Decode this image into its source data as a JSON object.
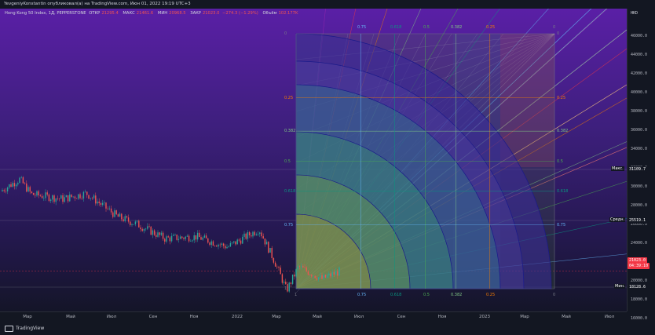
{
  "header": {
    "title": "YevgeniyKonstantin опубликовал(а) на TradingView.com, Июн 01, 2022 19:19 UTC+3"
  },
  "legend": {
    "symbol": "Hong Kong 50 Index, 1Д, PEPPERSTONE",
    "open_label": "ОТКР",
    "open_value": "21295.4",
    "high_label": "МАКС",
    "high_value": "21461.6",
    "low_label": "МИН",
    "low_value": "20968.5",
    "close_label": "ЗАКР",
    "close_value": "21023.0",
    "change": "−274.3 (−1.29%)",
    "volume_label": "Объём",
    "volume_value": "102.177K"
  },
  "price_axis": {
    "currency": "HKD",
    "ticks": [
      "46000.0",
      "44000.0",
      "42000.0",
      "40000.0",
      "38000.0",
      "36000.0",
      "34000.0",
      "32000.0",
      "30000.0",
      "28000.0",
      "26000.0",
      "24000.0",
      "22000.0",
      "20000.0",
      "18000.0",
      "16000.0"
    ],
    "max_label": "Макс.",
    "max_value": "31109.7",
    "avg_label": "Средн.",
    "avg_value": "25519.1",
    "min_label": "Мин.",
    "min_value": "18128.6",
    "current_price": "21023.0",
    "countdown": "04:39:10"
  },
  "time_axis": {
    "ticks": [
      "Мар",
      "Май",
      "Июл",
      "Сен",
      "Ноя",
      "2022",
      "Мар",
      "Май",
      "Июл",
      "Сен",
      "Ноя",
      "2023",
      "Мар",
      "Май",
      "Июл"
    ]
  },
  "fib_levels": {
    "left": [
      "0",
      "0.25",
      "0.382",
      "0.5",
      "0.618",
      "0.75",
      "1"
    ],
    "right": [
      "0",
      "0.25",
      "0.382",
      "0.5",
      "0.618",
      "0.75"
    ],
    "top": [
      "0.75",
      "0.618",
      "0.5",
      "0.382",
      "0.25",
      "0"
    ],
    "bottom": [
      "1",
      "0.75",
      "0.618",
      "0.5",
      "0.382",
      "0.25",
      "0"
    ]
  },
  "colors": {
    "background": "#131722",
    "candle_up": "#26a69a",
    "candle_down": "#ef5350",
    "current_price": "#f23645",
    "fib_0": "#787b86",
    "fib_025": "#f57c00",
    "fib_0382": "#81c784",
    "fib_05": "#4caf50",
    "fib_0618": "#089981",
    "fib_075": "#64b5f6",
    "fib_1": "#787b86"
  },
  "footer": {
    "brand": "TradingView"
  }
}
